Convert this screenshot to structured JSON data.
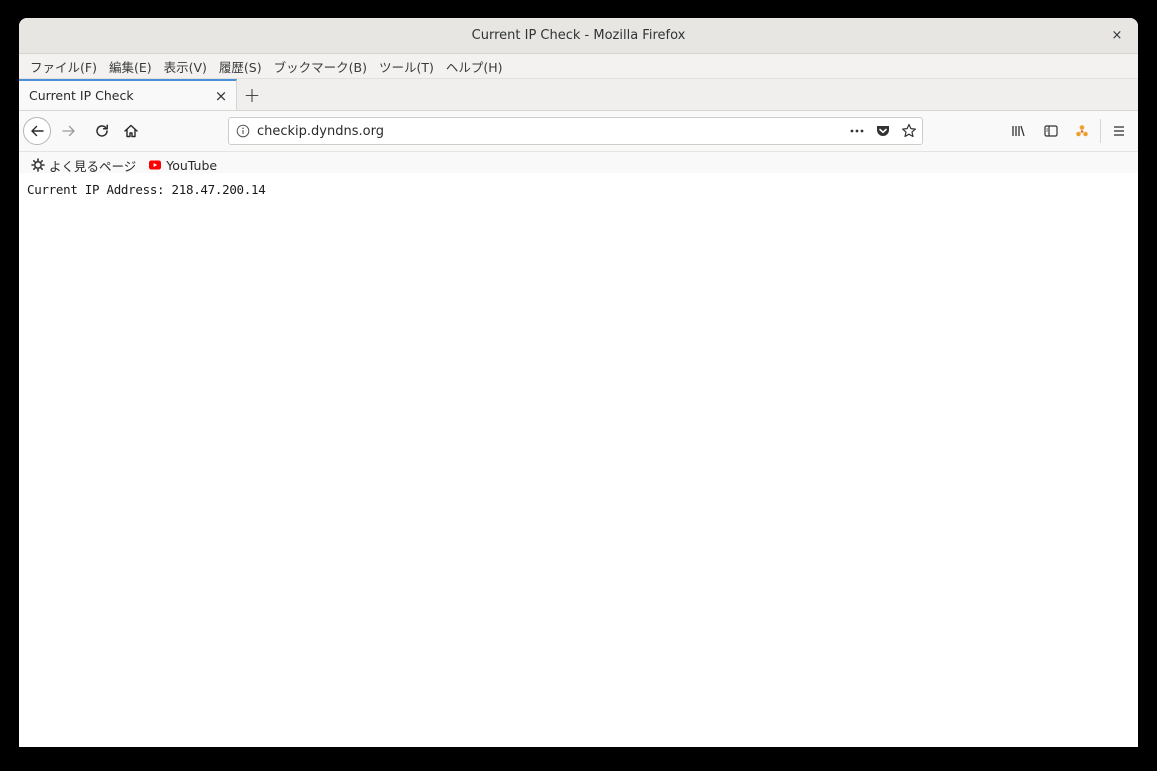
{
  "window": {
    "title": "Current IP Check - Mozilla Firefox",
    "close_glyph": "×"
  },
  "menubar": {
    "items": [
      "ファイル(F)",
      "編集(E)",
      "表示(V)",
      "履歴(S)",
      "ブックマーク(B)",
      "ツール(T)",
      "ヘルプ(H)"
    ]
  },
  "tabs": [
    {
      "label": "Current IP Check",
      "close_glyph": "×"
    }
  ],
  "newtab_glyph": "+",
  "navbar": {
    "url": "checkip.dyndns.org",
    "icons": [
      "back-icon",
      "forward-icon",
      "reload-icon",
      "home-icon",
      "info-icon",
      "page-actions-icon",
      "pocket-icon",
      "bookmark-star-icon",
      "library-icon",
      "sidebar-icon",
      "extension-icon",
      "menu-icon"
    ]
  },
  "bookmarks": {
    "items": [
      {
        "label": "よく見るページ",
        "icon": "gear-icon"
      },
      {
        "label": "YouTube",
        "icon": "youtube-icon",
        "color": "#ff0000"
      }
    ]
  },
  "page": {
    "text": "Current IP Address: 218.47.200.14"
  }
}
